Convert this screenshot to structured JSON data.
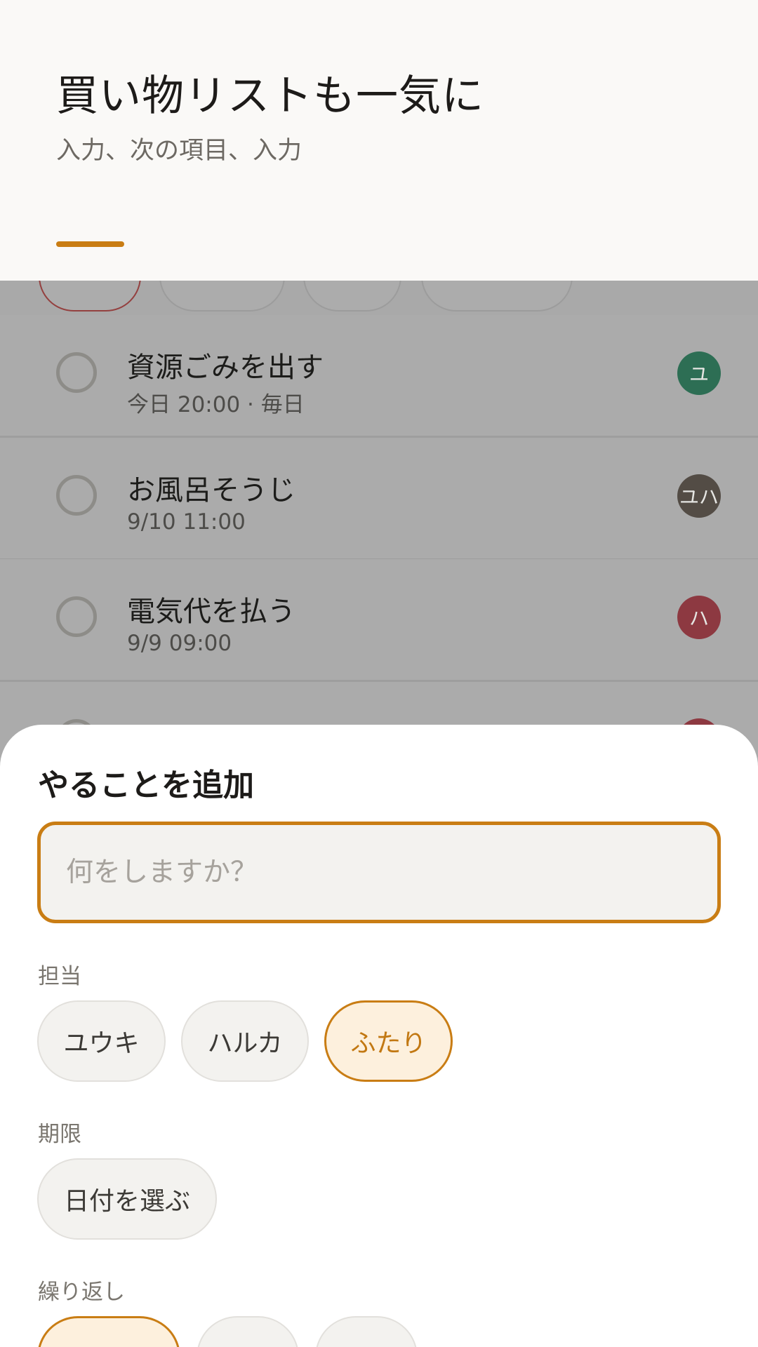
{
  "coach": {
    "title": "買い物リストも一気に",
    "subtitle": "入力、次の項目、入力"
  },
  "tasks": [
    {
      "title": "資源ごみを出す",
      "meta": "今日 20:00 · 毎日",
      "assignee": "ユ",
      "color": "#2d6e54"
    },
    {
      "title": "お風呂そうじ",
      "meta": "9/10 11:00",
      "assignee": "ユハ",
      "color": "#534c45"
    },
    {
      "title": "電気代を払う",
      "meta": "9/9 09:00",
      "assignee": "ハ",
      "color": "#8d3941"
    }
  ],
  "sheet": {
    "title": "やることを追加",
    "input_placeholder": "何をしますか？",
    "assignee_label": "担当",
    "assignees": [
      "ユウキ",
      "ハルカ",
      "ふたり"
    ],
    "selected_assignee": "ふたり",
    "due_label": "期限",
    "due_button": "日付を選ぶ",
    "repeat_label": "繰り返し"
  },
  "colors": {
    "accent": "#c97d14",
    "accent_bg": "#fdf0dd",
    "scrim": "#ababab"
  }
}
